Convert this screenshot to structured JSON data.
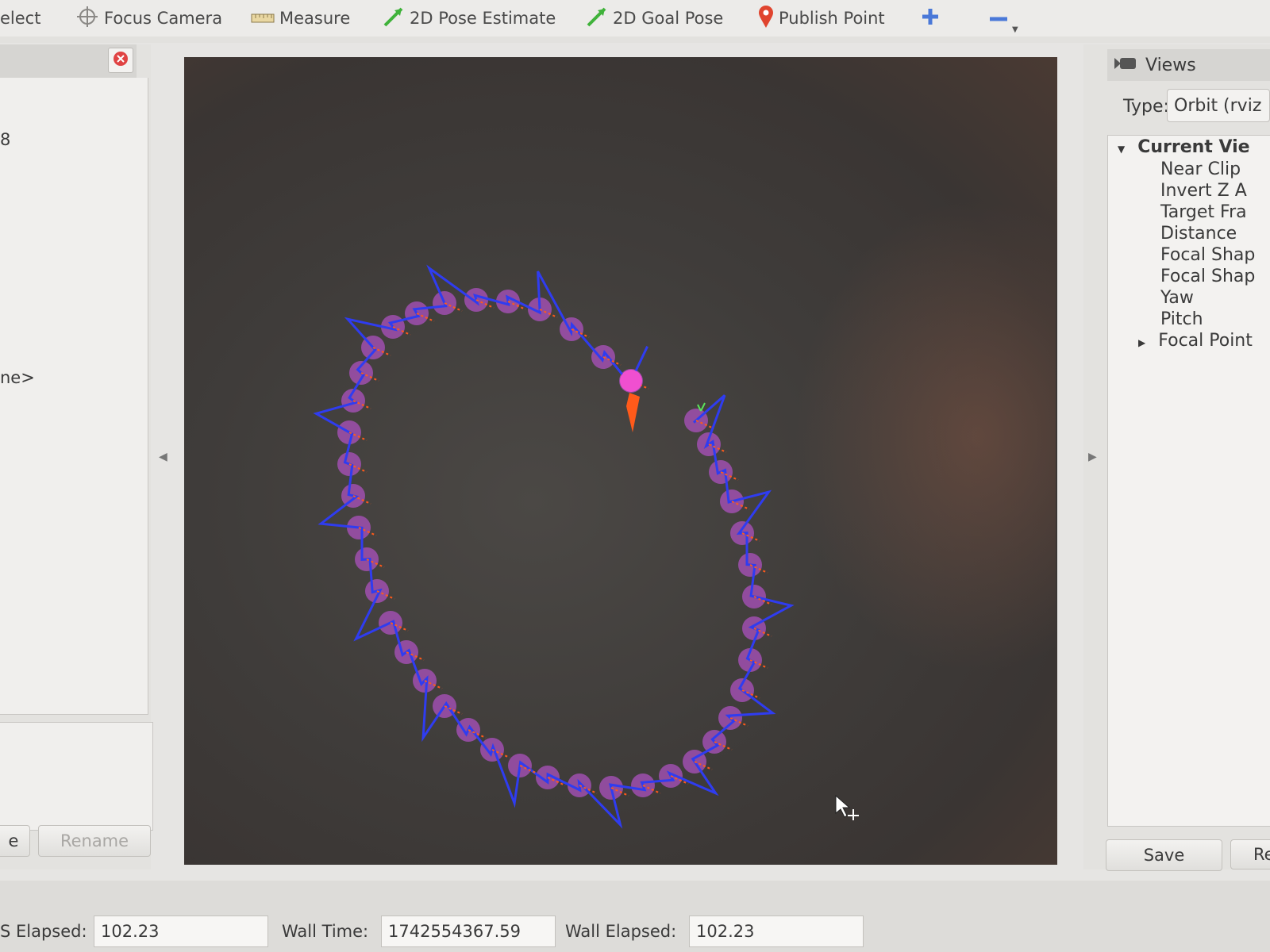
{
  "toolbar": {
    "select_label": "elect",
    "focus_camera_label": "Focus Camera",
    "measure_label": "Measure",
    "pose_estimate_label": "2D Pose Estimate",
    "goal_pose_label": "2D Goal Pose",
    "publish_point_label": "Publish Point"
  },
  "left_panel": {
    "value_fragment": "8",
    "name_fragment": "ne>",
    "remove_label": "e",
    "rename_label": "Rename"
  },
  "views_panel": {
    "title": "Views",
    "type_label": "Type:",
    "type_value": "Orbit (rviz",
    "current_view_label": "Current Vie",
    "properties": [
      "Near Clip",
      "Invert Z A",
      "Target Fra",
      "Distance",
      "Focal Shap",
      "Focal Shap",
      "Yaw",
      "Pitch"
    ],
    "focal_point_label": "Focal Point",
    "save_label": "Save",
    "remove_label": "Re"
  },
  "time_panel": {
    "ros_elapsed_label": "S Elapsed:",
    "ros_elapsed_value": "102.23",
    "wall_time_label": "Wall Time:",
    "wall_time_value": "1742554367.59",
    "wall_elapsed_label": "Wall Elapsed:",
    "wall_elapsed_value": "102.23"
  },
  "colors": {
    "path": "#2f3cf0",
    "pose_marker": "#b452c8",
    "current_marker": "#f04fd0",
    "arrow": "#ff5a1a",
    "background": "#3f3c3a"
  }
}
